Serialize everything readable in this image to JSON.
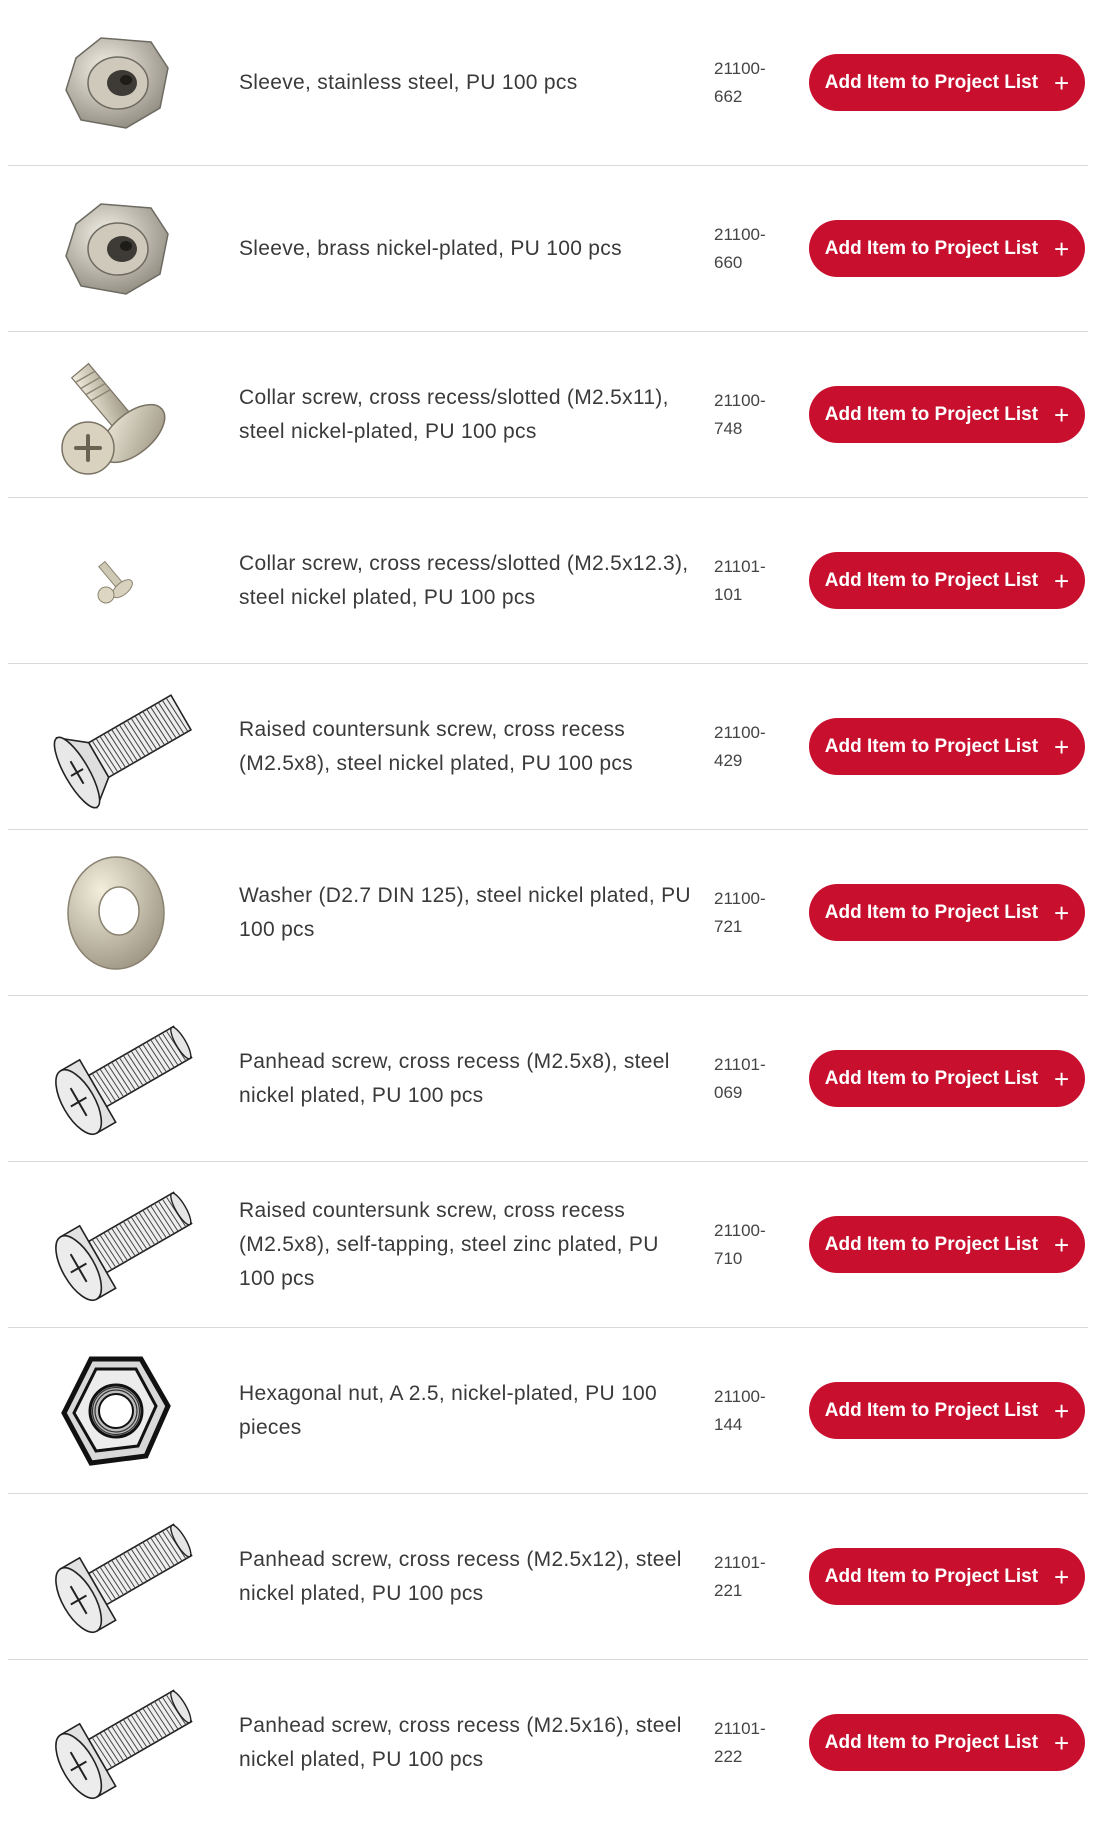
{
  "button_label": "Add Item to Project List",
  "button_plus": "+",
  "accent_color": "#c8102e",
  "items": [
    {
      "description": "Sleeve, stainless steel, PU 100 pcs",
      "part_number": "21100-662",
      "icon": "hex-sleeve-icon"
    },
    {
      "description": "Sleeve, brass nickel-plated, PU 100 pcs",
      "part_number": "21100-660",
      "icon": "hex-sleeve-icon"
    },
    {
      "description": "Collar screw, cross recess/slotted (M2.5x11), steel nickel-plated, PU 100 pcs",
      "part_number": "21100-748",
      "icon": "collar-screw-icon"
    },
    {
      "description": "Collar screw, cross recess/slotted (M2.5x12.3), steel nickel plated, PU 100 pcs",
      "part_number": "21101-101",
      "icon": "small-screw-icon"
    },
    {
      "description": "Raised countersunk screw, cross recess (M2.5x8), steel nickel plated, PU 100 pcs",
      "part_number": "21100-429",
      "icon": "countersunk-screw-icon"
    },
    {
      "description": "Washer (D2.7 DIN 125), steel nickel plated, PU 100 pcs",
      "part_number": "21100-721",
      "icon": "washer-icon"
    },
    {
      "description": "Panhead screw, cross recess (M2.5x8), steel nickel plated, PU 100 pcs",
      "part_number": "21101-069",
      "icon": "panhead-screw-icon"
    },
    {
      "description": "Raised countersunk screw, cross recess (M2.5x8), self-tapping, steel zinc plated, PU 100 pcs",
      "part_number": "21100-710",
      "icon": "panhead-screw-icon"
    },
    {
      "description": "Hexagonal nut, A 2.5, nickel-plated, PU 100 pieces",
      "part_number": "21100-144",
      "icon": "hex-nut-icon"
    },
    {
      "description": "Panhead screw, cross recess (M2.5x12), steel nickel plated, PU 100 pcs",
      "part_number": "21101-221",
      "icon": "panhead-screw-icon"
    },
    {
      "description": "Panhead screw, cross recess (M2.5x16), steel nickel plated, PU 100 pcs",
      "part_number": "21101-222",
      "icon": "panhead-screw-icon"
    }
  ]
}
